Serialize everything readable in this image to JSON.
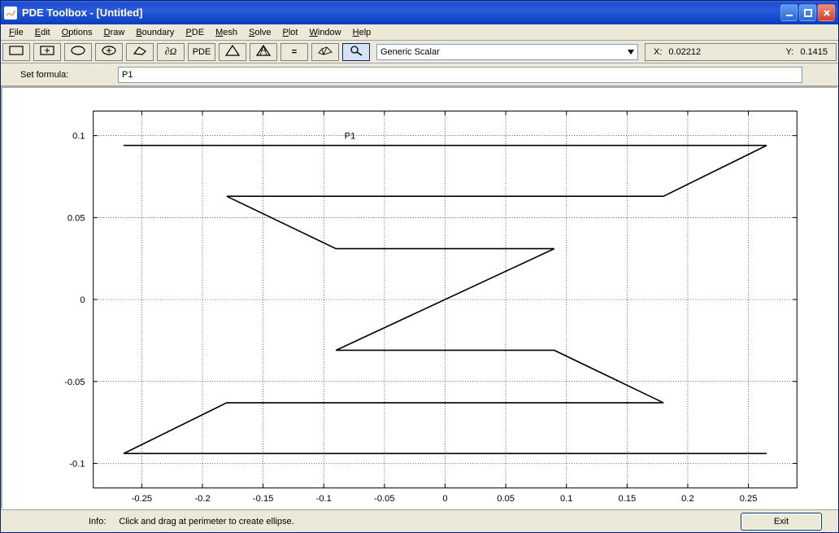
{
  "window": {
    "title": "PDE Toolbox - [Untitled]"
  },
  "menu": {
    "file": "File",
    "edit": "Edit",
    "options": "Options",
    "draw": "Draw",
    "boundary": "Boundary",
    "pde": "PDE",
    "mesh": "Mesh",
    "solve": "Solve",
    "plot": "Plot",
    "windowm": "Window",
    "help": "Help"
  },
  "toolbar": {
    "icons": {
      "rect": "rectangle-icon",
      "rectc": "rectangle-center-icon",
      "ellipse": "ellipse-icon",
      "ellipsec": "ellipse-center-icon",
      "polygon": "polygon-icon",
      "boundary": "boundary-icon",
      "pde": "pde-icon",
      "mesh": "mesh-icon",
      "refine": "refine-mesh-icon",
      "solve": "solve-icon",
      "plot3d": "plot3d-icon",
      "zoom": "zoom-icon"
    },
    "pde_label": "PDE",
    "mode_selected": "Generic Scalar"
  },
  "coords": {
    "x_label": "X:",
    "x_value": "0.02212",
    "y_label": "Y:",
    "y_value": "0.1415"
  },
  "formula": {
    "label": "Set formula:",
    "value": "P1"
  },
  "chart_data": {
    "type": "polygon",
    "object_label": "P1",
    "object_label_pos": [
      -0.083,
      0.1
    ],
    "xticks": [
      -0.25,
      -0.2,
      -0.15,
      -0.1,
      -0.05,
      0,
      0.05,
      0.1,
      0.15,
      0.2,
      0.25
    ],
    "yticks": [
      -0.1,
      -0.05,
      0,
      0.05,
      0.1
    ],
    "xlim": [
      -0.29,
      0.29
    ],
    "ylim": [
      -0.115,
      0.115
    ],
    "polygon_points": [
      [
        -0.265,
        0.094
      ],
      [
        0.265,
        0.094
      ],
      [
        0.18,
        0.063
      ],
      [
        -0.18,
        0.063
      ],
      [
        -0.09,
        0.031
      ],
      [
        0.09,
        0.031
      ],
      [
        -0.09,
        -0.031
      ],
      [
        0.09,
        -0.031
      ],
      [
        0.18,
        -0.063
      ],
      [
        -0.18,
        -0.063
      ],
      [
        -0.265,
        -0.094
      ],
      [
        0.265,
        -0.094
      ]
    ]
  },
  "status": {
    "info_label": "Info:",
    "info_text": "Click and drag at perimeter to create ellipse."
  },
  "buttons": {
    "exit": "Exit"
  }
}
